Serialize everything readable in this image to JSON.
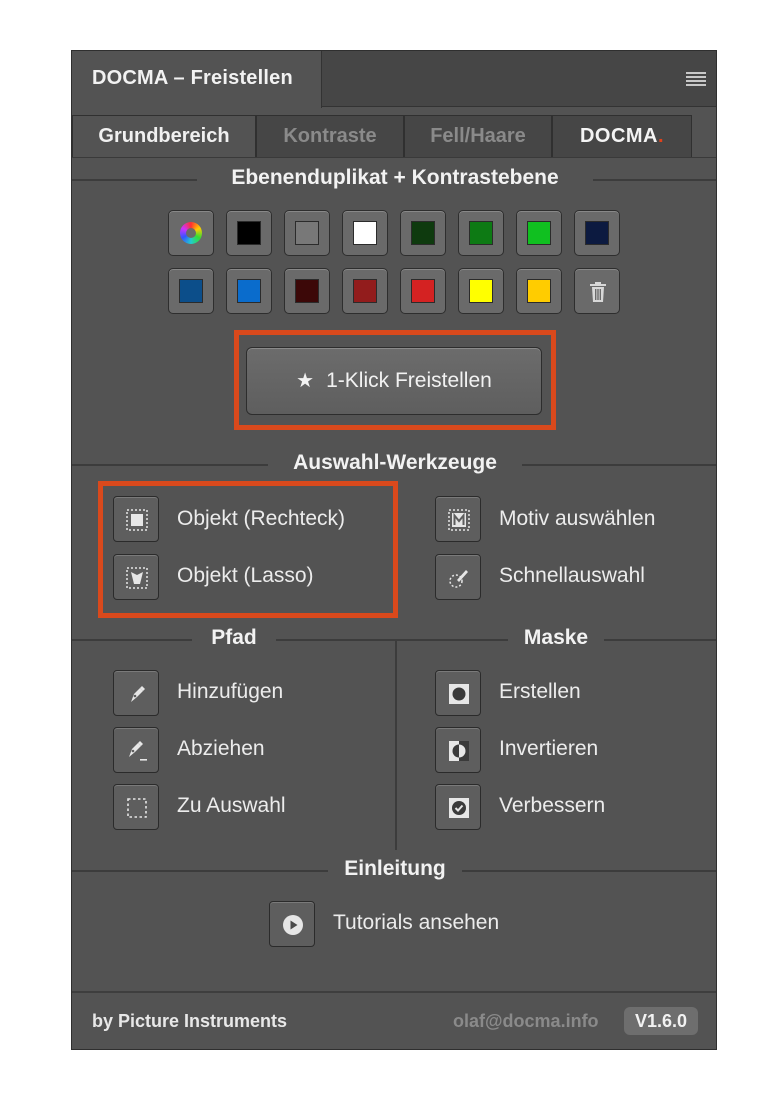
{
  "header": {
    "title": "DOCMA – Freistellen"
  },
  "tabs": [
    {
      "label": "Grundbereich",
      "active": true
    },
    {
      "label": "Kontraste",
      "active": false
    },
    {
      "label": "Fell/Haare",
      "active": false
    },
    {
      "label": "DOCMA",
      "active": false
    }
  ],
  "sections": {
    "duplicate": "Ebenenduplikat + Kontrastebene",
    "selection": "Auswahl-Werkzeuge",
    "path": "Pfad",
    "mask": "Maske",
    "intro": "Einleitung"
  },
  "swatches": {
    "row1": [
      "color-wheel",
      "#000000",
      "#787878",
      "#ffffff",
      "#0e3a0e",
      "#0d7a14",
      "#10c020",
      "#0c1a40"
    ],
    "row2": [
      "#0c4e8a",
      "#0a6ccc",
      "#3c0808",
      "#921c1c",
      "#d42222",
      "#ffff00",
      "#ffcc00",
      "trash"
    ]
  },
  "one_click": {
    "label": "1-Klick Freistellen",
    "icon": "star-icon"
  },
  "selection_tools": {
    "rect": "Objekt (Rechteck)",
    "lasso": "Objekt (Lasso)",
    "motif": "Motiv auswählen",
    "quick": "Schnellauswahl"
  },
  "path_tools": {
    "add": "Hinzufügen",
    "subtract": "Abziehen",
    "to_selection": "Zu Auswahl"
  },
  "mask_tools": {
    "create": "Erstellen",
    "invert": "Invertieren",
    "refine": "Verbessern"
  },
  "intro": {
    "tutorials": "Tutorials ansehen"
  },
  "footer": {
    "by": "by Picture Instruments",
    "email": "olaf@docma.info",
    "version": "V1.6.0"
  },
  "accent_color": "#d9491c"
}
